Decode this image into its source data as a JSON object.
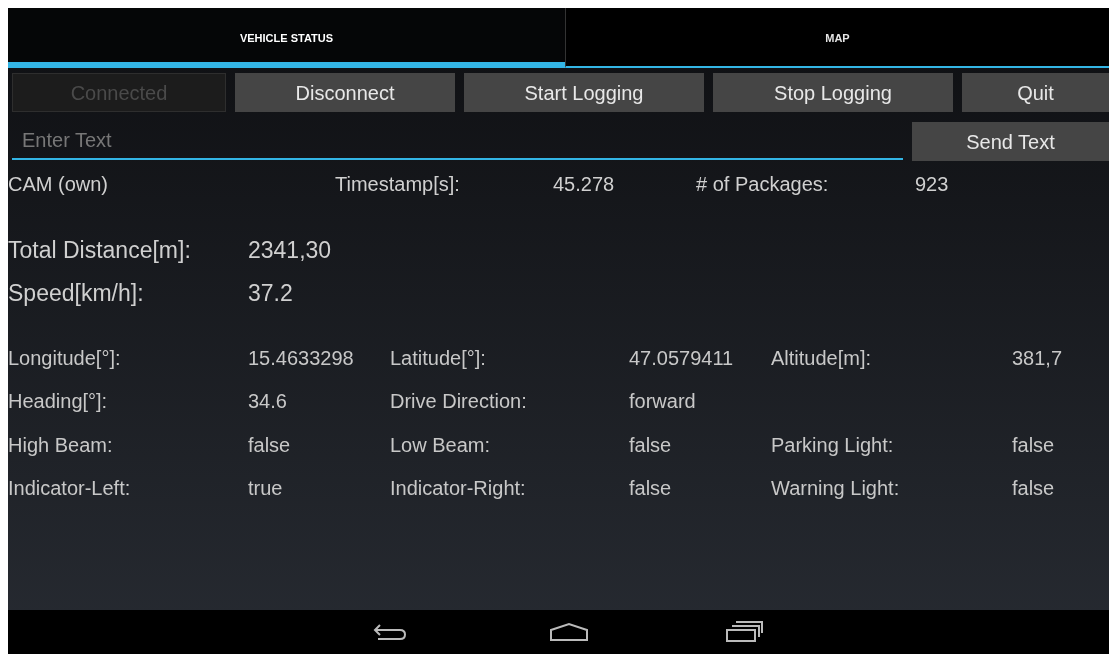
{
  "tabs": [
    {
      "label": "VEHICLE STATUS",
      "selected": true
    },
    {
      "label": "MAP",
      "selected": false
    }
  ],
  "buttons": [
    {
      "label": "Connected",
      "disabled": true
    },
    {
      "label": "Disconnect",
      "disabled": false
    },
    {
      "label": "Start Logging",
      "disabled": false
    },
    {
      "label": "Stop Logging",
      "disabled": false
    },
    {
      "label": "Quit",
      "disabled": false
    }
  ],
  "message": {
    "placeholder": "Enter Text",
    "send_button": "Send Text"
  },
  "header": {
    "title": "CAM (own)",
    "fields": [
      {
        "label": "Timestamp[s]:",
        "value": "45.278"
      },
      {
        "label": "# of Packages:",
        "value": "923"
      }
    ]
  },
  "summary": [
    {
      "label": "Total Distance[m]:",
      "value": "2341,30"
    },
    {
      "label": "Speed[km/h]:",
      "value": "37.2"
    }
  ],
  "details": [
    [
      {
        "label": "Longitude[°]:",
        "value": "15.4633298"
      },
      {
        "label": "Latitude[°]:",
        "value": "47.0579411"
      },
      {
        "label": "Altitude[m]:",
        "value": "381,7"
      }
    ],
    [
      {
        "label": "Heading[°]:",
        "value": "34.6"
      },
      {
        "label": "Drive Direction:",
        "value": "forward"
      }
    ],
    [
      {
        "label": "High Beam:",
        "value": "false"
      },
      {
        "label": "Low Beam:",
        "value": "false"
      },
      {
        "label": "Parking Light:",
        "value": "false"
      }
    ],
    [
      {
        "label": "Indicator-Left:",
        "value": "true"
      },
      {
        "label": "Indicator-Right:",
        "value": "false"
      },
      {
        "label": "Warning Light:",
        "value": "false"
      }
    ]
  ]
}
